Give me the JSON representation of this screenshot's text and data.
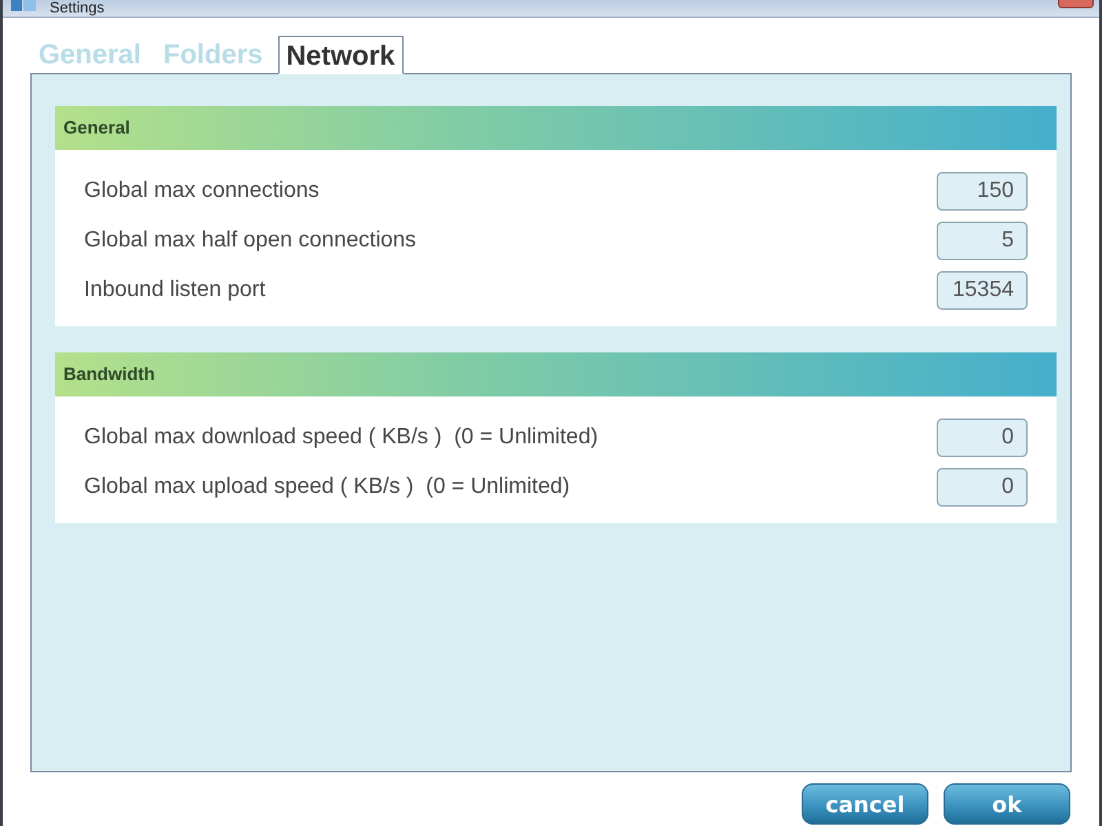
{
  "window": {
    "title": "Settings"
  },
  "tabs": [
    {
      "label": "General",
      "selected": false
    },
    {
      "label": "Folders",
      "selected": false
    },
    {
      "label": "Network",
      "selected": true
    }
  ],
  "sections": [
    {
      "title": "General",
      "fields": [
        {
          "label": "Global max connections",
          "value": "150"
        },
        {
          "label": "Global max half open connections",
          "value": "5"
        },
        {
          "label": "Inbound listen port",
          "value": "15354"
        }
      ]
    },
    {
      "title": "Bandwidth",
      "fields": [
        {
          "label": "Global max download speed ( KB/s )  (0 = Unlimited)",
          "value": "0"
        },
        {
          "label": "Global max upload speed ( KB/s )  (0 = Unlimited)",
          "value": "0"
        }
      ]
    }
  ],
  "buttons": [
    "cancel",
    "ok"
  ]
}
